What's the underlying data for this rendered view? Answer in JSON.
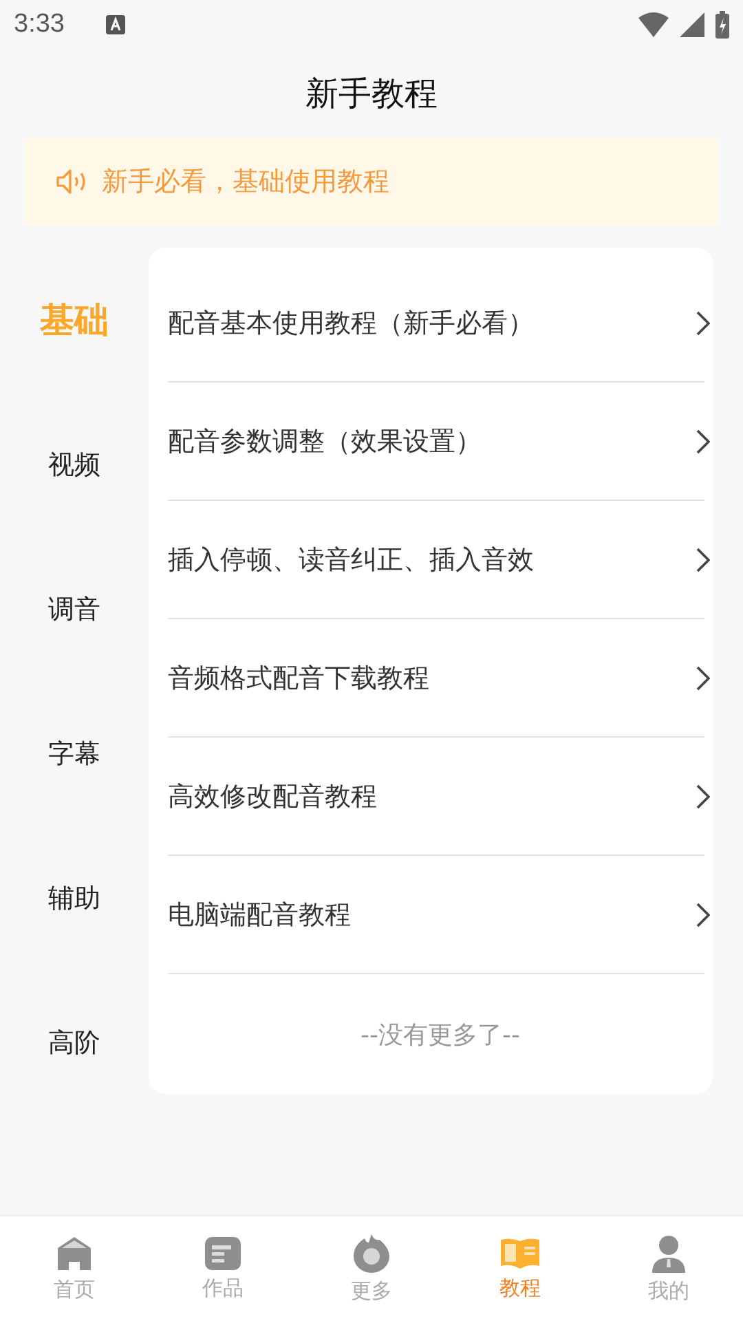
{
  "status_bar": {
    "time": "3:33"
  },
  "title": "新手教程",
  "notice": "新手必看，基础使用教程",
  "categories": [
    {
      "label": "基础",
      "selected": true
    },
    {
      "label": "视频",
      "selected": false
    },
    {
      "label": "调音",
      "selected": false
    },
    {
      "label": "字幕",
      "selected": false
    },
    {
      "label": "辅助",
      "selected": false
    },
    {
      "label": "高阶",
      "selected": false
    }
  ],
  "tutorials": [
    "配音基本使用教程（新手必看）",
    "配音参数调整（效果设置）",
    "插入停顿、读音纠正、插入音效",
    "音频格式配音下载教程",
    "高效修改配音教程",
    "电脑端配音教程"
  ],
  "end_note": "--没有更多了--",
  "nav": [
    {
      "label": "首页",
      "kind": "home",
      "selected": false
    },
    {
      "label": "作品",
      "kind": "works",
      "selected": false
    },
    {
      "label": "更多",
      "kind": "more",
      "selected": false
    },
    {
      "label": "教程",
      "kind": "book",
      "selected": true
    },
    {
      "label": "我的",
      "kind": "profile",
      "selected": false
    }
  ]
}
